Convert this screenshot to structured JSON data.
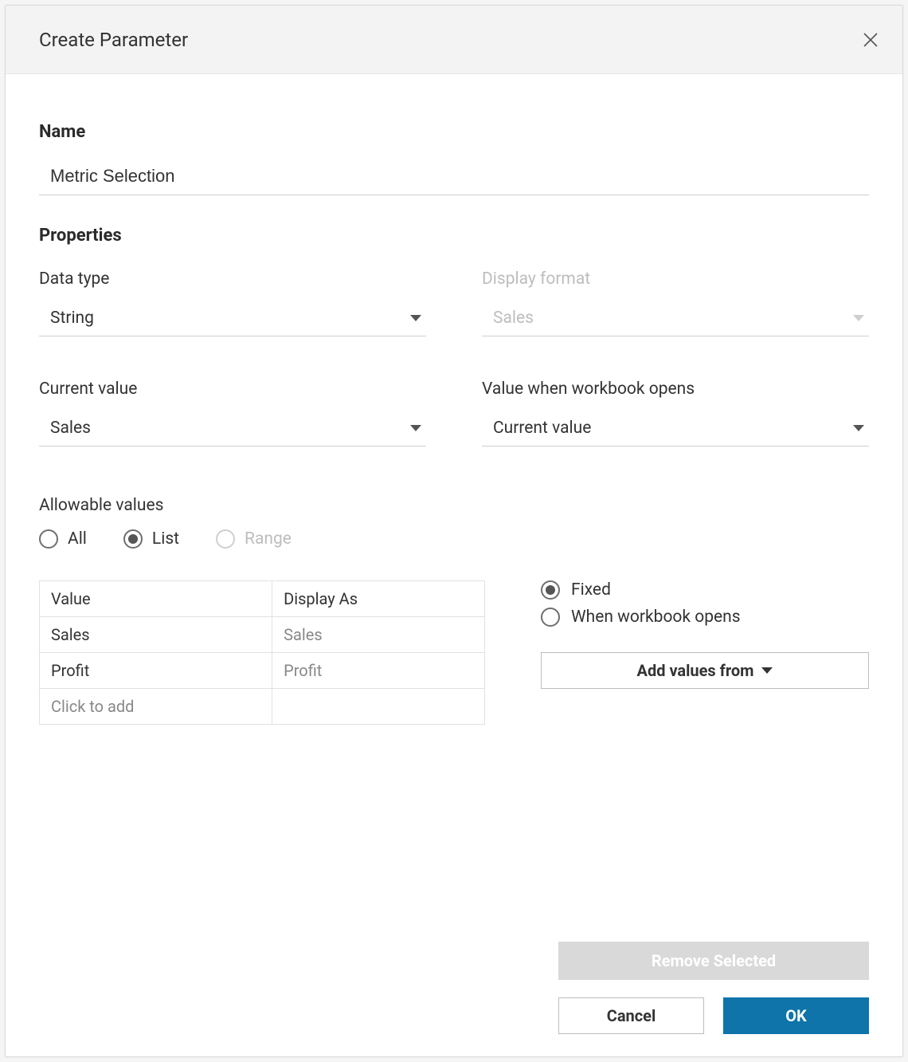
{
  "dialog": {
    "title": "Create Parameter"
  },
  "name": {
    "label": "Name",
    "value": "Metric Selection"
  },
  "properties": {
    "label": "Properties",
    "data_type": {
      "label": "Data type",
      "value": "String"
    },
    "display_format": {
      "label": "Display format",
      "value": "Sales"
    },
    "current_value": {
      "label": "Current value",
      "value": "Sales"
    },
    "value_on_open": {
      "label": "Value when workbook opens",
      "value": "Current value"
    }
  },
  "allowable": {
    "label": "Allowable values",
    "options": {
      "all": "All",
      "list": "List",
      "range": "Range"
    },
    "selected": "list"
  },
  "values_table": {
    "headers": {
      "value": "Value",
      "display_as": "Display As"
    },
    "rows": [
      {
        "value": "Sales",
        "display": "Sales"
      },
      {
        "value": "Profit",
        "display": "Profit"
      }
    ],
    "placeholder": "Click to add"
  },
  "source": {
    "fixed": "Fixed",
    "on_open": "When workbook opens",
    "selected": "fixed",
    "add_values": "Add values from"
  },
  "buttons": {
    "remove_selected": "Remove Selected",
    "cancel": "Cancel",
    "ok": "OK"
  }
}
